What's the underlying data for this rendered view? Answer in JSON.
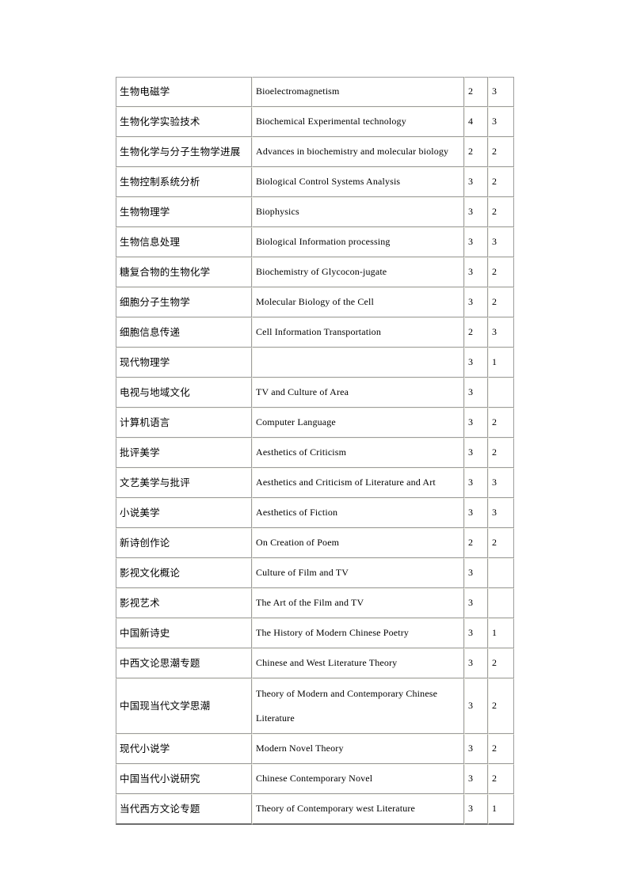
{
  "document": {
    "page_background": "#ffffff",
    "table_border_color": "#9d9d9d"
  },
  "table": {
    "columns": [
      "chinese_name",
      "english_name",
      "credits",
      "hours"
    ],
    "rows": [
      {
        "cn": "生物电磁学",
        "en": [
          "Bioelectromagnetism"
        ],
        "c1": "2",
        "c2": "3"
      },
      {
        "cn": "生物化学实验技术",
        "en": [
          "Biochemical  Experimental  technology"
        ],
        "c1": "4",
        "c2": "3"
      },
      {
        "cn": "生物化学与分子生物学进展",
        "en": [
          "Advances in biochemistry and molecular  biology"
        ],
        "c1": "2",
        "c2": "2"
      },
      {
        "cn": "生物控制系统分析",
        "en": [
          "Biological  Control Systems Analysis"
        ],
        "c1": "3",
        "c2": "2"
      },
      {
        "cn": "生物物理学",
        "en": [
          "Biophysics"
        ],
        "c1": "3",
        "c2": "2"
      },
      {
        "cn": "生物信息处理",
        "en": [
          "Biological  Information processing"
        ],
        "c1": "3",
        "c2": "3"
      },
      {
        "cn": "糖复合物的生物化学",
        "en": [
          "Biochemistry of Glycocon-jugate"
        ],
        "c1": "3",
        "c2": "2"
      },
      {
        "cn": "细胞分子生物学",
        "en": [
          "Molecular Biology of the Cell"
        ],
        "c1": "3",
        "c2": "2"
      },
      {
        "cn": "细胞信息传递",
        "en": [
          "Cell Information Transportation"
        ],
        "c1": "2",
        "c2": "3"
      },
      {
        "cn": "现代物理学",
        "en": [
          ""
        ],
        "c1": "3",
        "c2": "1"
      },
      {
        "cn": "电视与地域文化",
        "en": [
          "TV and Culture of Area"
        ],
        "c1": "3",
        "c2": ""
      },
      {
        "cn": "计算机语言",
        "en": [
          "Computer Language"
        ],
        "c1": "3",
        "c2": "2"
      },
      {
        "cn": "批评美学",
        "en": [
          "Aesthetics of Criticism"
        ],
        "c1": "3",
        "c2": "2"
      },
      {
        "cn": "文艺美学与批评",
        "en": [
          "Aesthetics and Criticism of Literature  and Art"
        ],
        "c1": "3",
        "c2": "3"
      },
      {
        "cn": "小说美学",
        "en": [
          "Aesthetics of Fiction"
        ],
        "c1": "3",
        "c2": "3"
      },
      {
        "cn": "新诗创作论",
        "en": [
          "On Creation of Poem"
        ],
        "c1": "2",
        "c2": "2"
      },
      {
        "cn": "影视文化概论",
        "en": [
          "Culture of Film and TV"
        ],
        "c1": "3",
        "c2": ""
      },
      {
        "cn": "影视艺术",
        "en": [
          "The Art of the Film and TV"
        ],
        "c1": "3",
        "c2": ""
      },
      {
        "cn": "中国新诗史",
        "en": [
          "The History of Modern Chinese Poetry"
        ],
        "c1": "3",
        "c2": "1"
      },
      {
        "cn": "中西文论思潮专题",
        "en": [
          "Chinese and West Literature  Theory"
        ],
        "c1": "3",
        "c2": "2"
      },
      {
        "cn": "中国现当代文学思潮",
        "en": [
          "Theory of Modern and Contemporary Chinese",
          "Literature"
        ],
        "c1": "3",
        "c2": "2",
        "tall": true
      },
      {
        "cn": "现代小说学",
        "en": [
          "Modern Novel Theory"
        ],
        "c1": "3",
        "c2": "2"
      },
      {
        "cn": "中国当代小说研究",
        "en": [
          "Chinese Contemporary Novel"
        ],
        "c1": "3",
        "c2": "2"
      },
      {
        "cn": "当代西方文论专题",
        "en": [
          "Theory of Contemporary west Literature"
        ],
        "c1": "3",
        "c2": "1"
      }
    ]
  }
}
